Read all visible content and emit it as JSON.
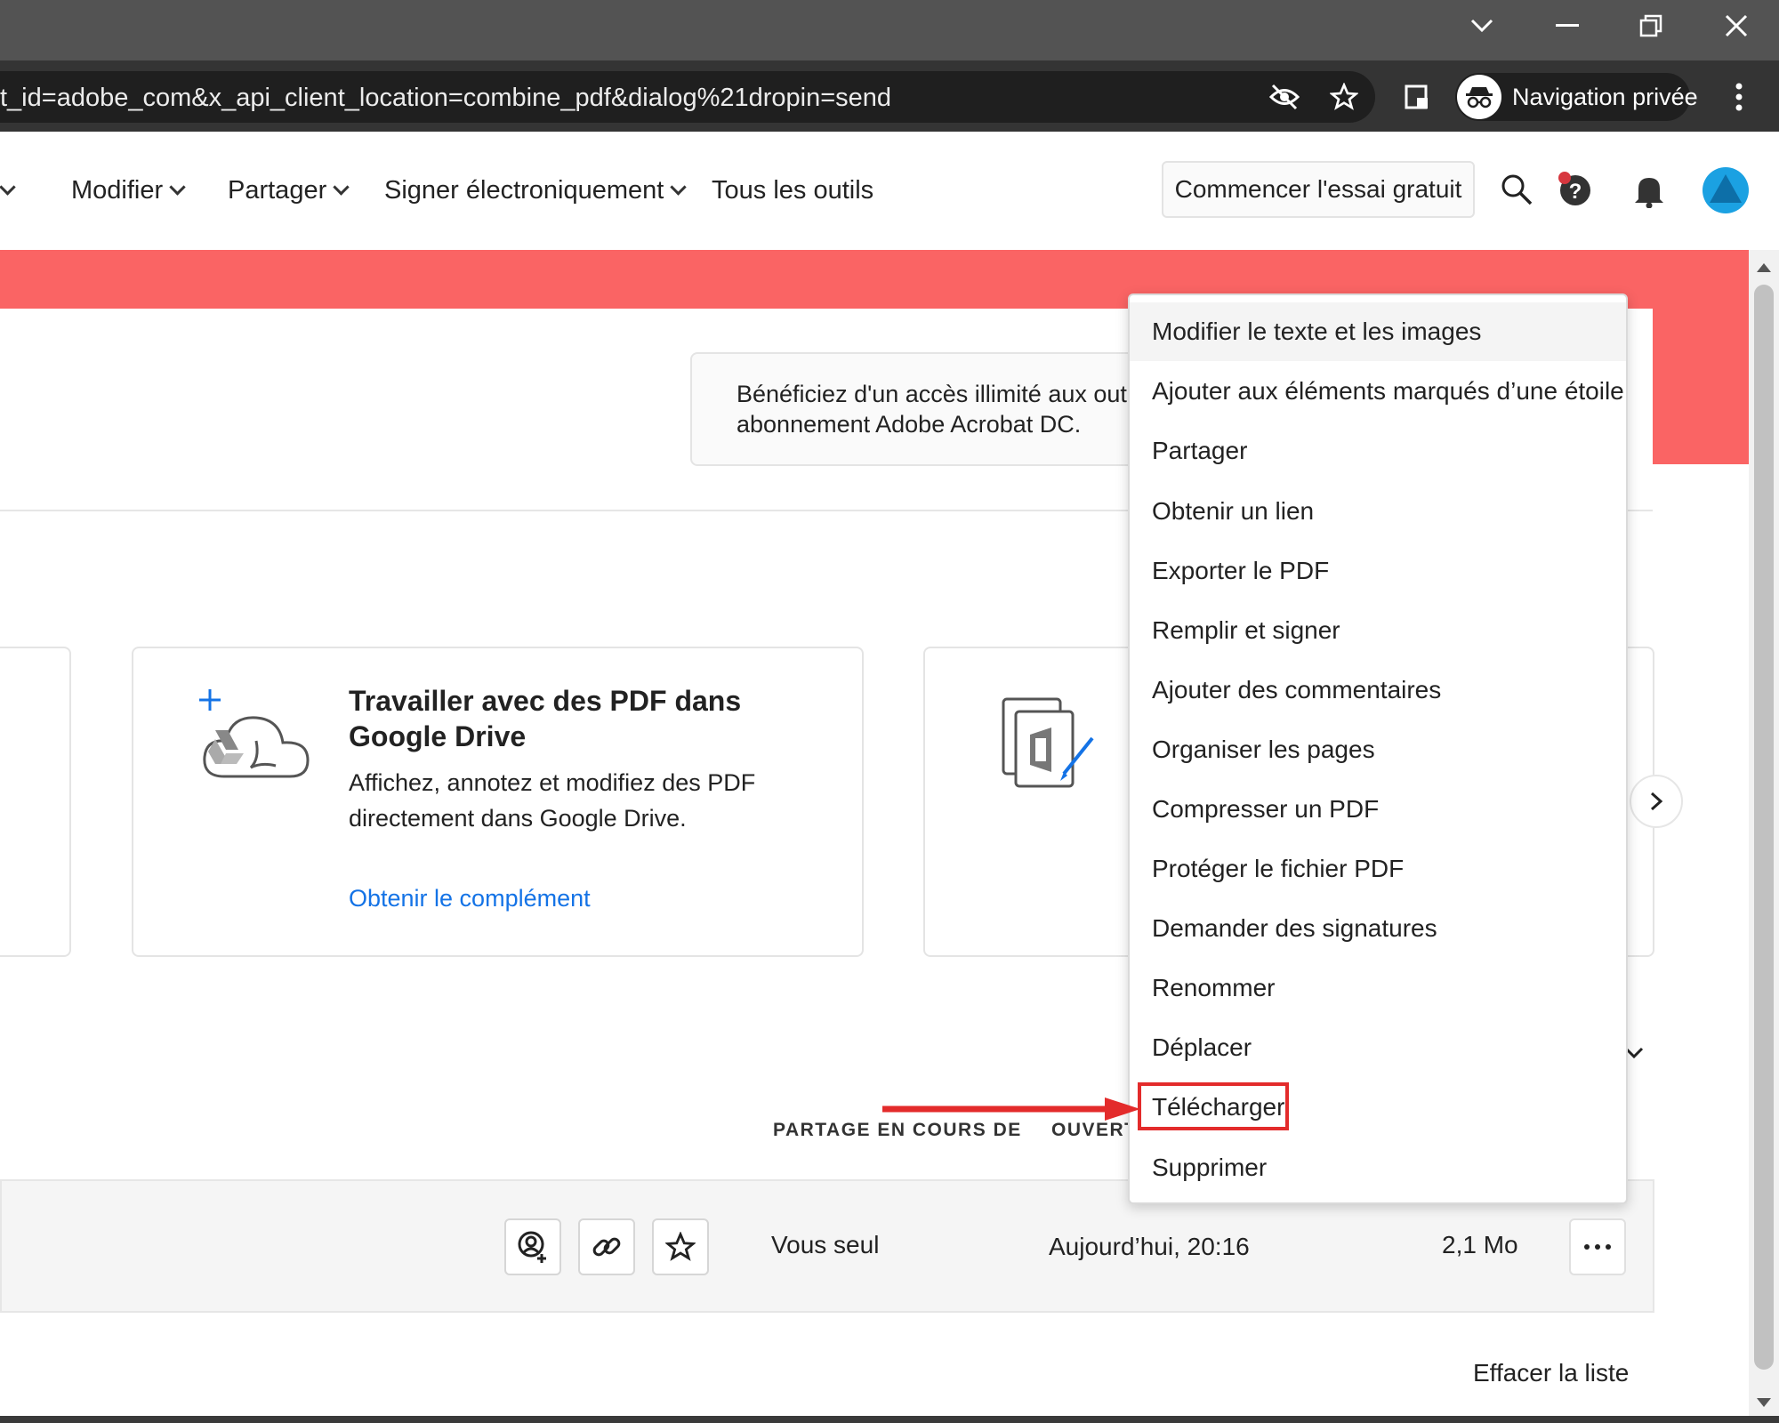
{
  "browser": {
    "url": "t_id=adobe_com&x_api_client_location=combine_pdf&dialog%21dropin=send",
    "incognito_label": "Navigation privée"
  },
  "nav": {
    "items": [
      "Modifier",
      "Partager",
      "Signer électroniquement",
      "Tous les outils"
    ],
    "trial_button": "Commencer l'essai gratuit"
  },
  "promo": {
    "line1": "Bénéficiez d'un accès illimité aux outi",
    "line2": "abonnement Adobe Acrobat DC."
  },
  "cards": {
    "gdrive": {
      "title": "Travailler avec des PDF dans Google Drive",
      "description": "Affichez, annotez et modifiez des PDF directement dans Google Drive.",
      "link": "Obtenir le complément"
    }
  },
  "file_list": {
    "column_shared": "PARTAGE EN COURS DE",
    "column_opened": "OUVERT",
    "row": {
      "shared_with": "Vous seul",
      "opened": "Aujourd’hui, 20:16",
      "size": "2,1 Mo"
    },
    "clear_label": "Effacer la liste"
  },
  "context_menu": {
    "items": [
      "Modifier le texte et les images",
      "Ajouter aux éléments marqués d’une étoile",
      "Partager",
      "Obtenir un lien",
      "Exporter le PDF",
      "Remplir et signer",
      "Ajouter des commentaires",
      "Organiser les pages",
      "Compresser un PDF",
      "Protéger le fichier PDF",
      "Demander des signatures",
      "Renommer",
      "Déplacer",
      "Télécharger",
      "Supprimer"
    ],
    "highlighted_item": "Télécharger"
  },
  "colors": {
    "banner": "#fa6464",
    "link": "#1473e6",
    "annotation": "#e32b2b"
  }
}
